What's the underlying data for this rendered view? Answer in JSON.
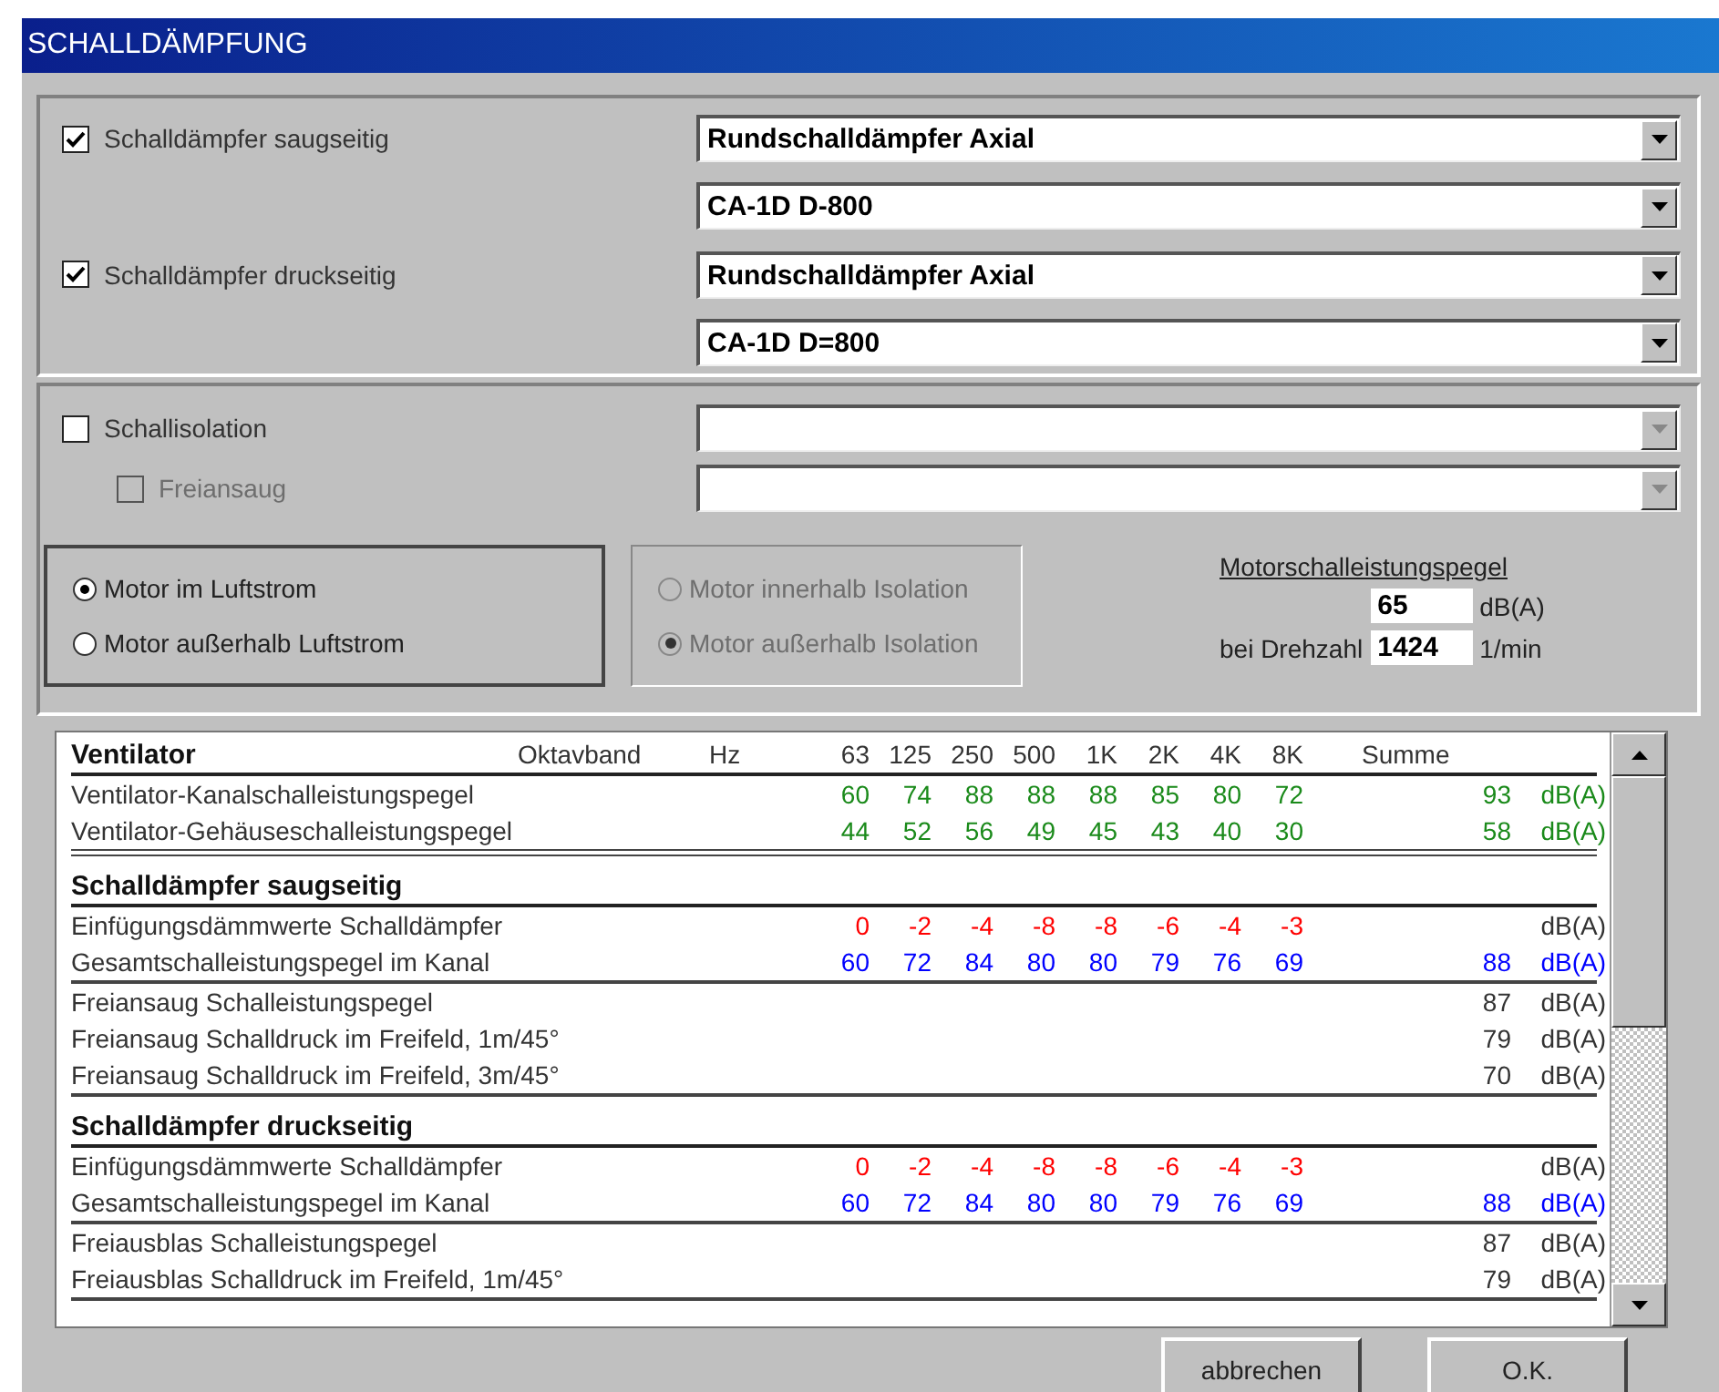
{
  "window": {
    "title": "SCHALLDÄMPFUNG"
  },
  "silencers": [
    {
      "label": "Schalldämpfer saugseitig",
      "checked": true,
      "type": "Rundschalldämpfer Axial",
      "model": "CA-1D D-800"
    },
    {
      "label": "Schalldämpfer druckseitig",
      "checked": true,
      "type": "Rundschalldämpfer Axial",
      "model": "CA-1D D=800"
    }
  ],
  "isolation": {
    "label": "Schallisolation",
    "checked": false,
    "combo_disabled": true,
    "sub": {
      "label": "Freiansaug",
      "checked": false,
      "disabled": true,
      "combo_disabled": true
    }
  },
  "motor_position": [
    {
      "label": "Motor im Luftstrom",
      "selected": true
    },
    {
      "label": "Motor außerhalb Luftstrom",
      "selected": false
    }
  ],
  "motor_isolation": {
    "disabled": true,
    "options": [
      {
        "label": "Motor innerhalb Isolation",
        "selected": false
      },
      {
        "label": "Motor außerhalb Isolation",
        "selected": true
      }
    ]
  },
  "motor_power": {
    "title": "Motorschalleistungspegel",
    "level_value": "65",
    "level_unit": "dB(A)",
    "speed_label": "bei Drehzahl",
    "speed_value": "1424",
    "speed_unit": "1/min"
  },
  "table": {
    "band_label": "Oktavband",
    "unit_label": "Hz",
    "bands": [
      "63",
      "125",
      "250",
      "500",
      "1K",
      "2K",
      "4K",
      "8K"
    ],
    "sum_label": "Summe",
    "sections": [
      {
        "title": "Ventilator",
        "groups": [
          [
            {
              "label": "Ventilator-Kanalschalleistungspegel",
              "color": "#1a8a1a",
              "values": [
                "60",
                "74",
                "88",
                "88",
                "88",
                "85",
                "80",
                "72"
              ],
              "sum": "93",
              "unit": "dB(A)"
            },
            {
              "label": "Ventilator-Gehäuseschalleistungspegel",
              "color": "#1a8a1a",
              "values": [
                "44",
                "52",
                "56",
                "49",
                "45",
                "43",
                "40",
                "30"
              ],
              "sum": "58",
              "unit": "dB(A)"
            }
          ]
        ]
      },
      {
        "title": "Schalldämpfer saugseitig",
        "groups": [
          [
            {
              "label": "Einfügungsdämmwerte Schalldämpfer",
              "color": "#ff0000",
              "values": [
                "0",
                "-2",
                "-4",
                "-8",
                "-8",
                "-6",
                "-4",
                "-3"
              ],
              "unit": "dB(A)"
            },
            {
              "label": "Gesamtschalleistungspegel im Kanal",
              "color": "#0000ff",
              "values": [
                "60",
                "72",
                "84",
                "80",
                "80",
                "79",
                "76",
                "69"
              ],
              "sum": "88",
              "unit": "dB(A)"
            }
          ],
          [
            {
              "label": "Freiansaug Schalleistungspegel",
              "sum": "87",
              "unit": "dB(A)"
            },
            {
              "label": "Freiansaug Schalldruck im Freifeld, 1m/45°",
              "sum": "79",
              "unit": "dB(A)"
            },
            {
              "label": "Freiansaug Schalldruck im Freifeld, 3m/45°",
              "sum": "70",
              "unit": "dB(A)"
            }
          ]
        ]
      },
      {
        "title": "Schalldämpfer druckseitig",
        "groups": [
          [
            {
              "label": "Einfügungsdämmwerte Schalldämpfer",
              "color": "#ff0000",
              "values": [
                "0",
                "-2",
                "-4",
                "-8",
                "-8",
                "-6",
                "-4",
                "-3"
              ],
              "unit": "dB(A)"
            },
            {
              "label": "Gesamtschalleistungspegel im Kanal",
              "color": "#0000ff",
              "values": [
                "60",
                "72",
                "84",
                "80",
                "80",
                "79",
                "76",
                "69"
              ],
              "sum": "88",
              "unit": "dB(A)"
            }
          ],
          [
            {
              "label": "Freiausblas Schalleistungspegel",
              "sum": "87",
              "unit": "dB(A)"
            },
            {
              "label": "Freiausblas Schalldruck im Freifeld, 1m/45°",
              "sum": "79",
              "unit": "dB(A)"
            }
          ]
        ]
      }
    ]
  },
  "buttons": [
    {
      "label": "abbrechen"
    },
    {
      "label": "O.K."
    }
  ]
}
